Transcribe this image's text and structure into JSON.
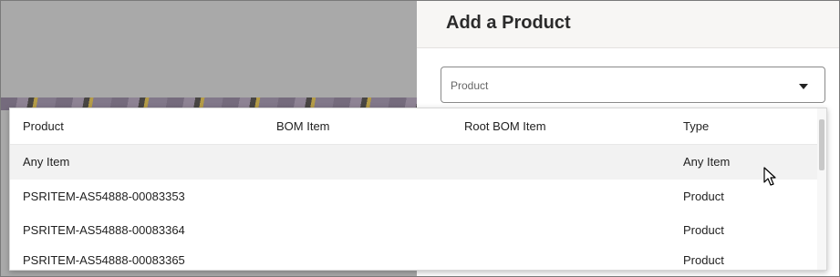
{
  "drawer": {
    "title": "Add a Product",
    "product_field": {
      "placeholder": "Product"
    }
  },
  "dropdown": {
    "columns": [
      "Product",
      "BOM Item",
      "Root BOM Item",
      "Type"
    ],
    "rows": [
      {
        "product": "Any Item",
        "bom_item": "",
        "root_bom_item": "",
        "type": "Any Item"
      },
      {
        "product": "PSRITEM-AS54888-00083353",
        "bom_item": "",
        "root_bom_item": "",
        "type": "Product"
      },
      {
        "product": "PSRITEM-AS54888-00083364",
        "bom_item": "",
        "root_bom_item": "",
        "type": "Product"
      },
      {
        "product": "PSRITEM-AS54888-00083365",
        "bom_item": "",
        "root_bom_item": "",
        "type": "Product"
      }
    ]
  }
}
